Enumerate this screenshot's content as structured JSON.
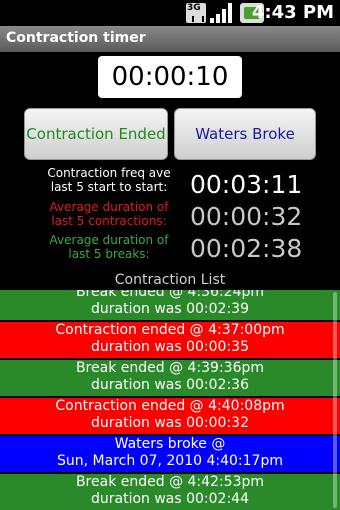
{
  "status_bar": {
    "network_label": "3G",
    "icons": [
      "3g-data-icon",
      "signal-strength-icon",
      "battery-icon"
    ],
    "time": "4:43 PM"
  },
  "app": {
    "title": "Contraction timer"
  },
  "timer": {
    "value": "00:00:10"
  },
  "buttons": {
    "contraction_ended": "Contraction Ended",
    "waters_broke": "Waters Broke"
  },
  "stats": {
    "freq_label": "Contraction freq ave last 5 start to start:",
    "freq_value": "00:03:11",
    "avg_contraction_label": "Average duration of last 5 contractions:",
    "avg_contraction_value": "00:00:32",
    "avg_break_label": "Average duration of last 5 breaks:",
    "avg_break_value": "00:02:38"
  },
  "list": {
    "header": "Contraction List",
    "items": [
      {
        "line1": "Break ended @ 4:36:24pm",
        "line2": "duration was 00:02:39",
        "color": "#2a8a2a"
      },
      {
        "line1": "Contraction ended @ 4:37:00pm",
        "line2": "duration was 00:00:35",
        "color": "#ff0000"
      },
      {
        "line1": "Break ended @ 4:39:36pm",
        "line2": "duration was 00:02:36",
        "color": "#2a8a2a"
      },
      {
        "line1": "Contraction ended @ 4:40:08pm",
        "line2": "duration was 00:00:32",
        "color": "#ff0000"
      },
      {
        "line1": "Waters broke @",
        "line2": "Sun, March 07, 2010 4:40:17pm",
        "color": "#0000ff"
      },
      {
        "line1": "Break ended @ 4:42:53pm",
        "line2": "duration was 00:02:44",
        "color": "#2a8a2a"
      }
    ]
  },
  "colors": {
    "break": "#2a8a2a",
    "contraction": "#ff0000",
    "waters": "#0000ff"
  }
}
